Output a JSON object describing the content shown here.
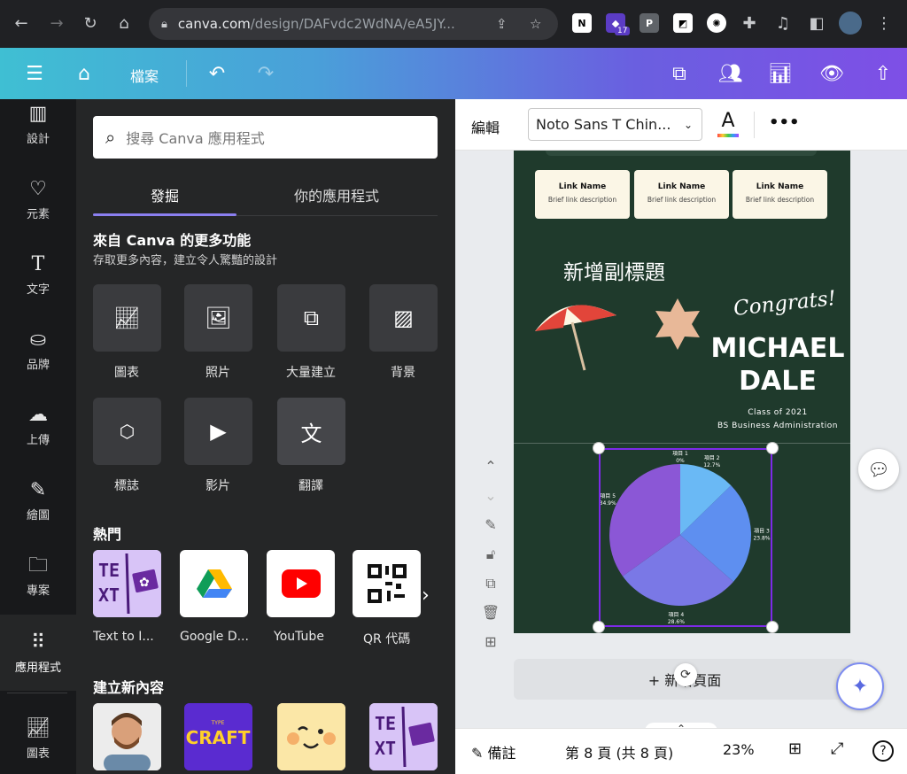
{
  "browser": {
    "url_host": "canva.com",
    "url_path": "/design/DAFvdc2WdNA/eA5JY...",
    "extension_badge": "17"
  },
  "header": {
    "file_menu": "檔案"
  },
  "rail": {
    "items": [
      {
        "label": "設計"
      },
      {
        "label": "元素"
      },
      {
        "label": "文字"
      },
      {
        "label": "品牌"
      },
      {
        "label": "上傳"
      },
      {
        "label": "繪圖"
      },
      {
        "label": "專案"
      },
      {
        "label": "應用程式"
      },
      {
        "label": "圖表"
      }
    ]
  },
  "panel": {
    "search_placeholder": "搜尋 Canva 應用程式",
    "tabs": [
      "發掘",
      "你的應用程式"
    ],
    "more_title": "來自 Canva 的更多功能",
    "more_subtitle": "存取更多內容，建立令人驚豔的設計",
    "features": [
      {
        "label": "圖表",
        "icon": "chart-icon"
      },
      {
        "label": "照片",
        "icon": "photo-icon"
      },
      {
        "label": "大量建立",
        "icon": "bulk-create-icon"
      },
      {
        "label": "背景",
        "icon": "background-icon"
      },
      {
        "label": "標誌",
        "icon": "logo-icon"
      },
      {
        "label": "影片",
        "icon": "video-icon"
      },
      {
        "label": "翻譯",
        "icon": "translate-icon"
      }
    ],
    "popular_title": "熱門",
    "popular": [
      {
        "label": "Text to I..."
      },
      {
        "label": "Google D..."
      },
      {
        "label": "YouTube"
      },
      {
        "label": "QR 代碼"
      }
    ],
    "create_title": "建立新內容"
  },
  "editor": {
    "edit_label": "編輯",
    "font_name": "Noto Sans T Chin...",
    "font_color_letter": "A",
    "design": {
      "link_cards": [
        {
          "name": "Link Name",
          "desc": "Brief link description"
        },
        {
          "name": "Link Name",
          "desc": "Brief link description"
        },
        {
          "name": "Link Name",
          "desc": "Brief link description"
        }
      ],
      "subtitle": "新增副標題",
      "congrats": "Congrats!",
      "name_line1": "MICHAEL",
      "name_line2": "DALE",
      "class_of": "Class of 2021",
      "degree": "BS Business Administration"
    },
    "add_page": "+ 新增頁面",
    "status": {
      "notes": "備註",
      "page": "第 8 頁 (共 8 頁)",
      "zoom": "23%",
      "help": "?"
    }
  },
  "chart_data": {
    "type": "pie",
    "categories": [
      "項目 1",
      "項目 2",
      "項目 3",
      "項目 4",
      "項目 5"
    ],
    "values": [
      0,
      12.7,
      23.8,
      28.6,
      34.9
    ],
    "value_labels": [
      "0%",
      "12.7%",
      "23.8%",
      "28.6%",
      "34.9%"
    ],
    "colors": [
      "#5aa8f0",
      "#6ab9f5",
      "#5e8ff0",
      "#7a78e6",
      "#8b57d6"
    ]
  }
}
